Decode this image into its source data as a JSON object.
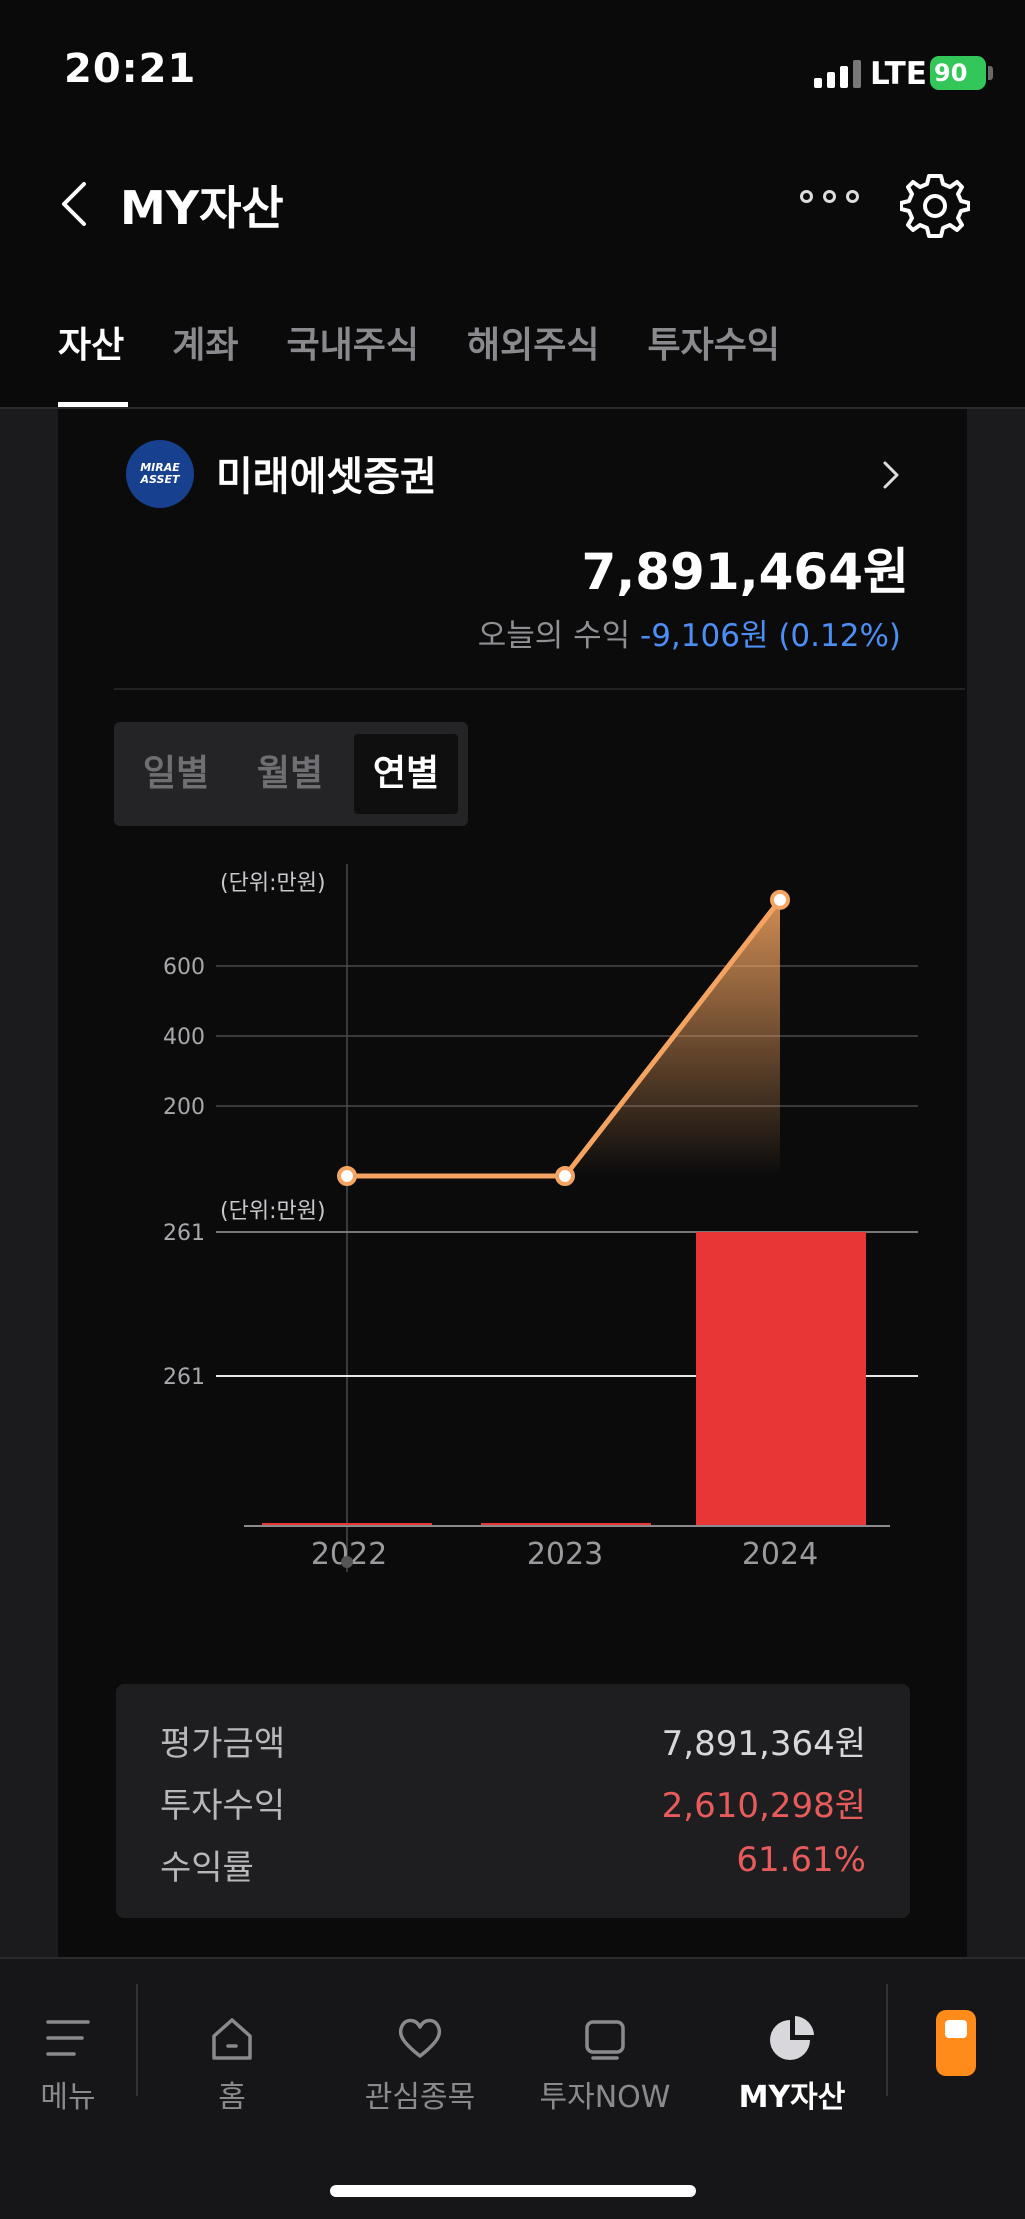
{
  "status_bar": {
    "time": "20:21",
    "network": "LTE",
    "battery": "90"
  },
  "header": {
    "title": "MY자산",
    "back_icon": "chevron-left-icon",
    "more_icon": "more-icon",
    "settings_icon": "gear-icon"
  },
  "tabs": [
    {
      "label": "자산",
      "active": true
    },
    {
      "label": "계좌",
      "active": false
    },
    {
      "label": "국내주식",
      "active": false
    },
    {
      "label": "해외주식",
      "active": false
    },
    {
      "label": "투자수익",
      "active": false
    }
  ],
  "account": {
    "logo_text": [
      "MIRAE",
      "ASSET"
    ],
    "broker": "미래에셋증권",
    "total": "7,891,464원",
    "today_label": "오늘의 수익",
    "today_value": "-9,106원 (0.12%)"
  },
  "period_tabs": [
    {
      "label": "일별",
      "active": false
    },
    {
      "label": "월별",
      "active": false
    },
    {
      "label": "연별",
      "active": true
    }
  ],
  "chart_data": [
    {
      "type": "area",
      "unit_label": "(단위:만원)",
      "x": [
        "2022",
        "2023",
        "2024"
      ],
      "y": [
        0,
        0,
        789
      ],
      "ytick_labels": [
        "200",
        "400",
        "600"
      ],
      "ytick_values": [
        200,
        400,
        600
      ],
      "line_color": "#f4a460"
    },
    {
      "type": "bar",
      "unit_label": "(단위:만원)",
      "categories": [
        "2022",
        "2023",
        "2024"
      ],
      "values": [
        0,
        0,
        261
      ],
      "ytick_labels": [
        "261",
        "261"
      ],
      "bar_color": "#e83535"
    }
  ],
  "summary": [
    {
      "label": "평가금액",
      "value": "7,891,364원",
      "color": "normal"
    },
    {
      "label": "투자수익",
      "value": "2,610,298원",
      "color": "red"
    },
    {
      "label": "수익률",
      "value": "61.61%",
      "color": "red"
    }
  ],
  "bottom_nav": [
    {
      "label": "메뉴",
      "icon": "menu-icon"
    },
    {
      "label": "홈",
      "icon": "home-icon"
    },
    {
      "label": "관심종목",
      "icon": "heart-icon"
    },
    {
      "label": "투자NOW",
      "icon": "tv-icon"
    },
    {
      "label": "MY자산",
      "icon": "pie-chart-icon",
      "active": true
    }
  ]
}
